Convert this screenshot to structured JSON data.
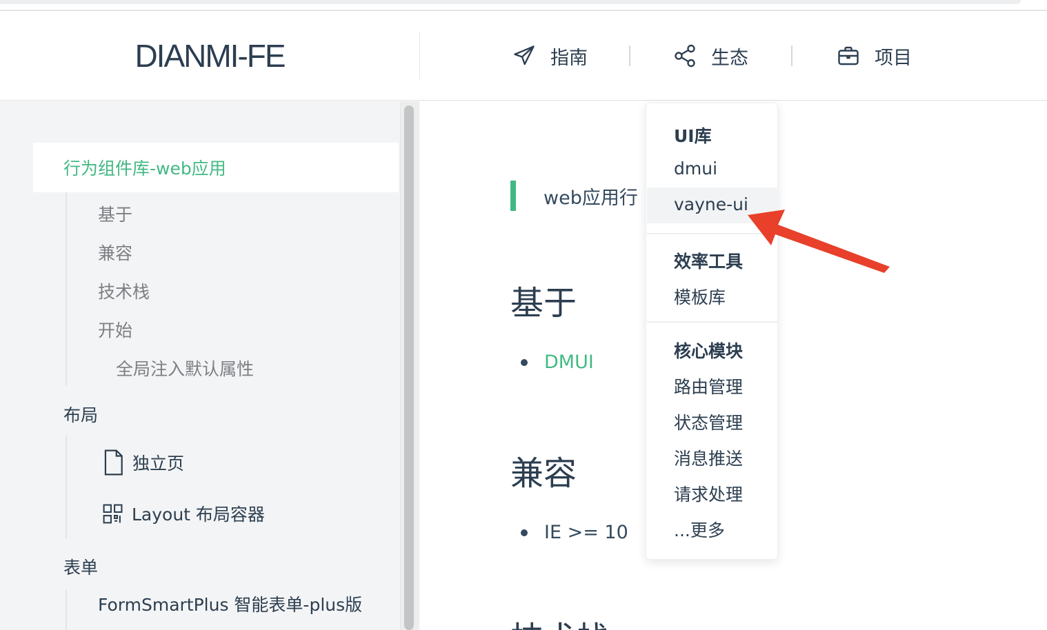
{
  "site": {
    "logo": "DIANMI-FE"
  },
  "nav": {
    "items": [
      {
        "label": "指南",
        "icon": "paper-plane-icon"
      },
      {
        "label": "生态",
        "icon": "share-icon"
      },
      {
        "label": "项目",
        "icon": "briefcase-icon"
      }
    ]
  },
  "dropdown": {
    "sections": [
      {
        "title": "UI库",
        "items": [
          "dmui",
          "vayne-ui"
        ]
      },
      {
        "title": "效率工具",
        "items": [
          "模板库"
        ]
      },
      {
        "title": "核心模块",
        "items": [
          "路由管理",
          "状态管理",
          "消息推送",
          "请求处理",
          "...更多"
        ]
      }
    ],
    "highlighted": "vayne-ui"
  },
  "sidebar": {
    "active": "行为组件库-web应用",
    "sub_links": [
      "基于",
      "兼容",
      "技术栈",
      "开始"
    ],
    "nested_link": "全局注入默认属性",
    "groups": [
      {
        "title": "布局",
        "items": [
          {
            "label": "独立页",
            "icon": "file-icon"
          },
          {
            "label": "Layout 布局容器",
            "icon": "qrcode-icon"
          }
        ]
      },
      {
        "title": "表单",
        "items": [
          {
            "label": "FormSmartPlus 智能表单-plus版"
          }
        ]
      }
    ]
  },
  "content": {
    "tip": "web应用行",
    "sections": [
      {
        "heading": "基于",
        "bullet": "DMUI"
      },
      {
        "heading": "兼容",
        "bullet": "IE >= 10"
      },
      {
        "heading": "技术栈"
      }
    ]
  },
  "colors": {
    "accent": "#42b983",
    "text": "#2c3e50",
    "arrow": "#e8402a"
  }
}
